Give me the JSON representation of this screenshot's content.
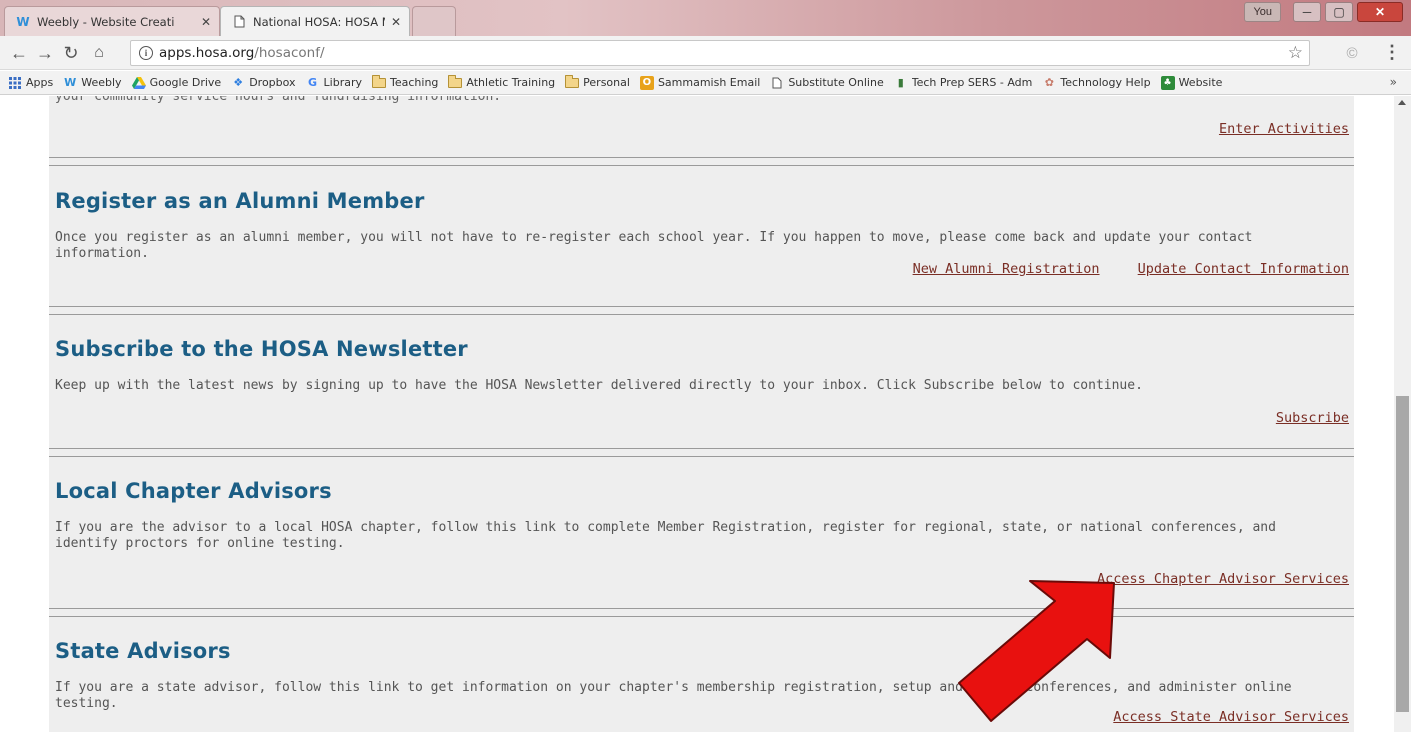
{
  "browser": {
    "tabs": [
      {
        "title": "Weebly - Website Creati",
        "icon": "weebly-icon"
      },
      {
        "title": "National HOSA: HOSA M",
        "icon": "page-icon"
      }
    ],
    "user_badge": "You",
    "url_host": "apps.hosa.org",
    "url_path": "/hosaconf/",
    "bookmarks": [
      {
        "label": "Apps",
        "icon": "apps-grid-icon"
      },
      {
        "label": "Weebly",
        "icon": "weebly-icon"
      },
      {
        "label": "Google Drive",
        "icon": "drive-icon"
      },
      {
        "label": "Dropbox",
        "icon": "dropbox-icon"
      },
      {
        "label": "Library",
        "icon": "google-icon"
      },
      {
        "label": "Teaching",
        "icon": "folder-icon"
      },
      {
        "label": "Athletic Training",
        "icon": "folder-icon"
      },
      {
        "label": "Personal",
        "icon": "folder-icon"
      },
      {
        "label": "Sammamish Email",
        "icon": "outlook-icon"
      },
      {
        "label": "Substitute Online",
        "icon": "page-icon"
      },
      {
        "label": "Tech Prep SERS - Adm",
        "icon": "leaf-icon"
      },
      {
        "label": "Technology Help",
        "icon": "brain-icon"
      },
      {
        "label": "Website",
        "icon": "tree-icon"
      }
    ]
  },
  "page": {
    "top_section": {
      "partial_text": "your community service hours and fundraising information.",
      "link": "Enter Activities"
    },
    "alumni": {
      "title": "Register as an Alumni Member",
      "body": "Once you register as an alumni member, you will not have to re-register each school year. If you happen to move, please come back and update your contact information.",
      "link1": "New Alumni Registration",
      "link2": "Update Contact Information"
    },
    "newsletter": {
      "title": "Subscribe to the HOSA Newsletter",
      "body": "Keep up with the latest news by signing up to have the HOSA Newsletter delivered directly to your inbox. Click Subscribe below to continue.",
      "link": "Subscribe"
    },
    "chapter": {
      "title": "Local Chapter Advisors",
      "body": "If you are the advisor to a local HOSA chapter, follow this link to complete Member Registration, register for regional, state, or national conferences, and identify proctors for online testing.",
      "link": "Access Chapter Advisor Services"
    },
    "state": {
      "title": "State Advisors",
      "body": "If you are a state advisor, follow this link to get information on your chapter's membership registration, setup and manage conferences, and administer online testing.",
      "link": "Access State Advisor Services"
    }
  },
  "colors": {
    "heading": "#1c5e85",
    "link": "#7a2e25",
    "section_bg": "#eeeeee",
    "annotation_arrow": "#e8110f"
  }
}
